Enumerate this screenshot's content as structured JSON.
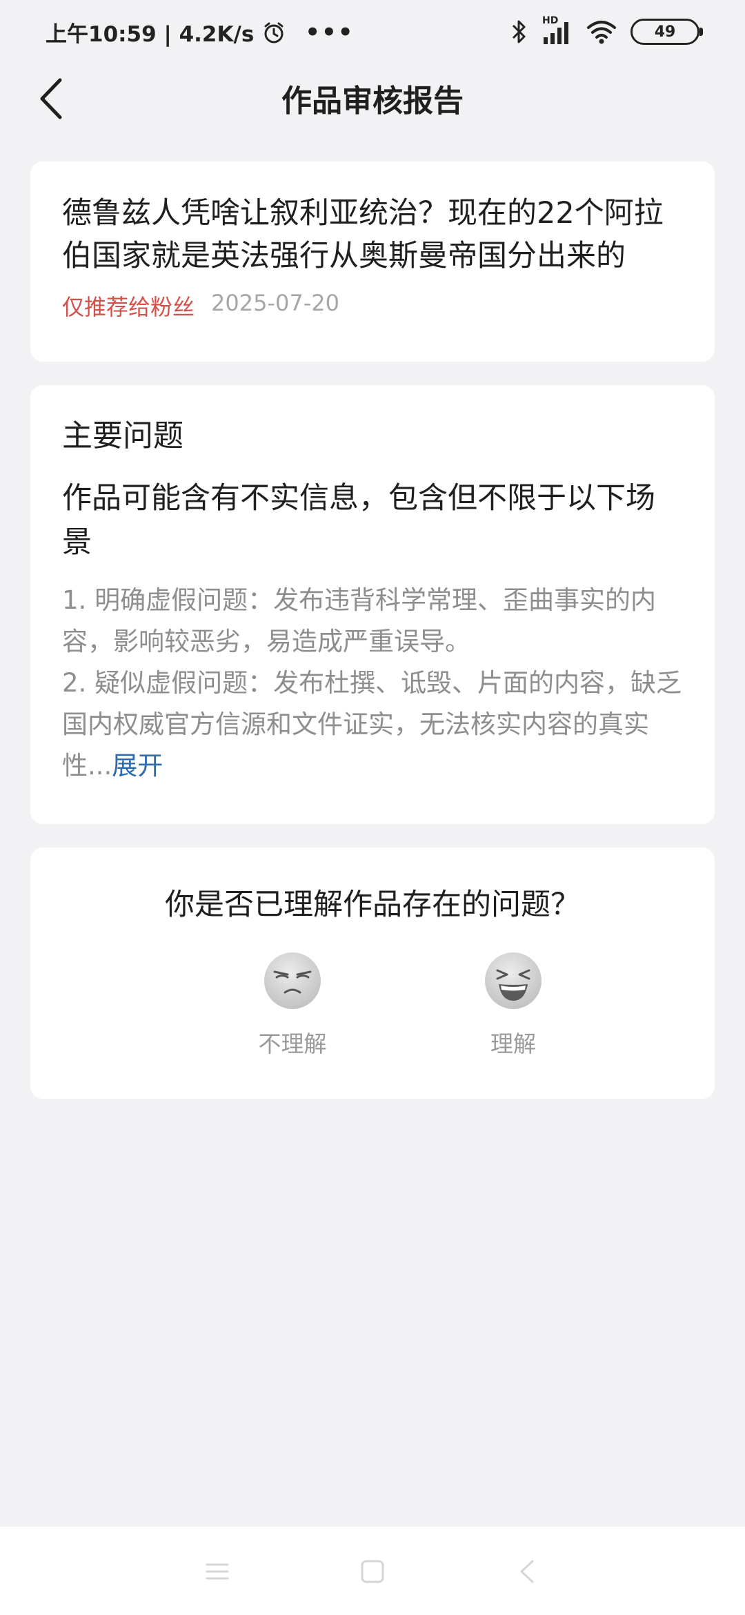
{
  "status_bar": {
    "time_speed": "上午10:59 | 4.2K/s",
    "more": "•••",
    "network_badge": "HD",
    "battery": "49",
    "icons": [
      "alarm-icon",
      "bluetooth-icon",
      "signal-icon",
      "wifi-icon",
      "battery-icon"
    ]
  },
  "header": {
    "back_icon": "back-arrow-icon",
    "title": "作品审核报告"
  },
  "article": {
    "title": "德鲁兹人凭啥让叙利亚统治？现在的22个阿拉伯国家就是英法强行从奥斯曼帝国分出来的",
    "tag": "仅推荐给粉丝",
    "date": "2025-07-20",
    "tag_color": "#d2524b"
  },
  "issue": {
    "heading": "主要问题",
    "summary": "作品可能含有不实信息，包含但不限于以下场景",
    "detail_1": "1. 明确虚假问题：发布违背科学常理、歪曲事实的内容，影响较恶劣，易造成严重误导。",
    "detail_2": "2. 疑似虚假问题：发布杜撰、诋毁、片面的内容，缺乏国内权威官方信源和文件证实，无法核实内容的真实性...",
    "expand": "展开",
    "link_color": "#2b6cb0"
  },
  "feedback": {
    "question": "你是否已理解作品存在的问题？",
    "options": [
      {
        "label": "不理解",
        "icon": "frowning-face-icon"
      },
      {
        "label": "理解",
        "icon": "laughing-face-icon"
      }
    ]
  },
  "system_nav": {
    "icons": [
      "menu-icon",
      "home-icon",
      "back-icon"
    ]
  }
}
